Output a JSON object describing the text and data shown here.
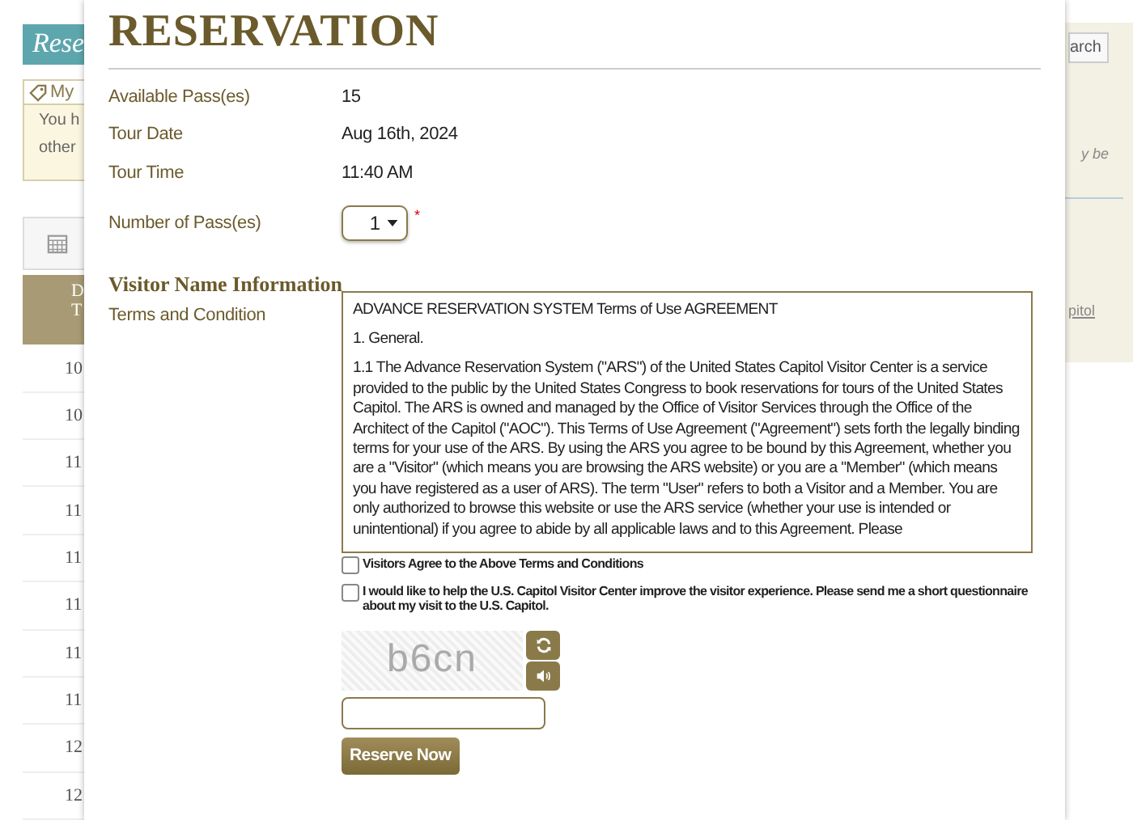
{
  "background_page": {
    "banner": "Rese",
    "notice": {
      "title": "My",
      "lines": [
        "You h",
        "other"
      ]
    },
    "table": {
      "header": [
        "D",
        "T"
      ],
      "rows": [
        "10",
        "10",
        "11",
        "11",
        "11",
        "11",
        "11",
        "11",
        "12",
        "12"
      ]
    },
    "search_button": "arch",
    "note": "y be",
    "link": "pitol"
  },
  "dialog": {
    "title": "RESERVATION",
    "details": [
      {
        "label": "Available Pass(es)",
        "value": "15"
      },
      {
        "label": "Tour Date",
        "value": "Aug 16th, 2024"
      },
      {
        "label": "Tour Time",
        "value": "11:40 AM"
      }
    ],
    "pass_count": {
      "label": "Number of Pass(es)",
      "value": "1",
      "required_mark": "*"
    },
    "section_title": "Visitor Name Information",
    "terms": {
      "label": "Terms and Condition",
      "heading": "ADVANCE RESERVATION SYSTEM Terms of Use AGREEMENT",
      "subheading": "1. General.",
      "paragraph": "1.1 The Advance Reservation System (\"ARS\") of the United States Capitol Visitor Center is a service provided to the public by the United States Congress to book reservations for tours of the United States Capitol. The ARS is owned and managed by the Office of Visitor Services through the Office of the Architect of the Capitol (\"AOC\"). This Terms of Use Agreement (\"Agreement\") sets forth the legally binding terms for your use of the ARS. By using the ARS you agree to be bound by this Agreement, whether you are a \"Visitor\" (which means you are browsing the ARS website) or you are a \"Member\" (which means you have registered as a user of ARS). The term \"User\" refers to both a Visitor and a Member. You are only authorized to browse this website or use the ARS service (whether your use is intended or unintentional) if you agree to abide by all applicable laws and to this Agreement. Please"
    },
    "checkboxes": [
      {
        "label": "Visitors Agree to the Above Terms and Conditions",
        "checked": false
      },
      {
        "label": "I would like to help the U.S. Capitol Visitor Center improve the visitor experience. Please send me a short questionnaire about my visit to the U.S. Capitol.",
        "checked": false
      }
    ],
    "captcha": {
      "text": "b6cn"
    },
    "submit": "Reserve Now"
  }
}
